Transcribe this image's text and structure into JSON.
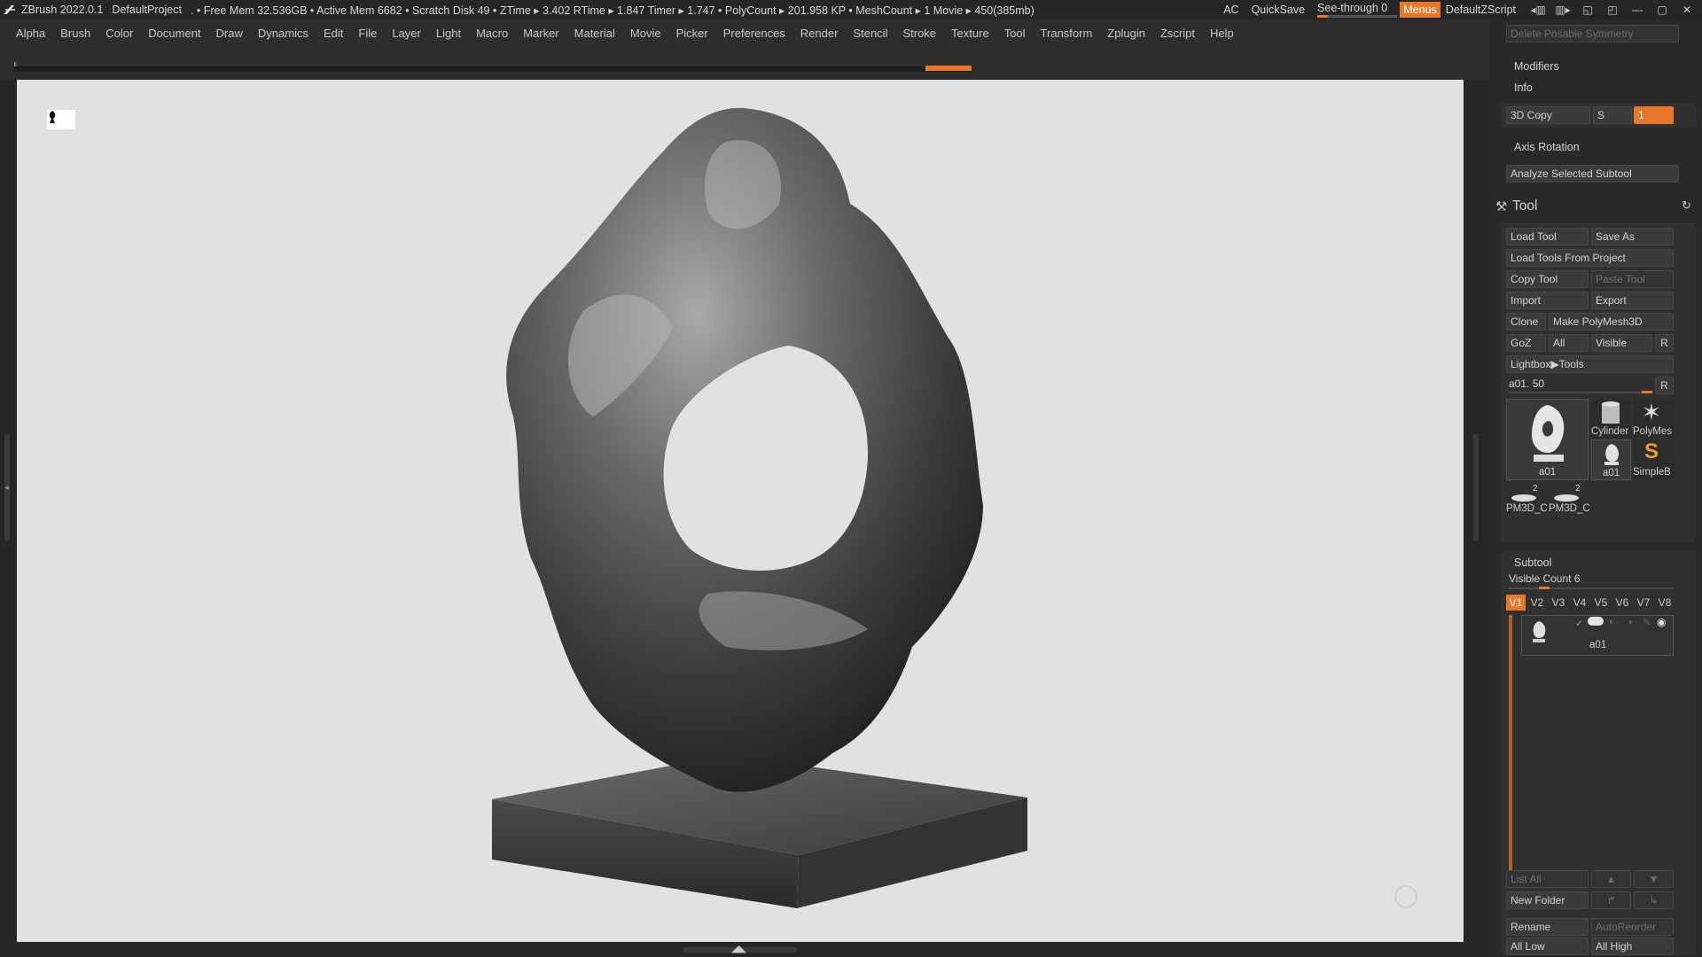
{
  "app": {
    "title": "ZBrush 2022.0.1",
    "project": "DefaultProject",
    "stats": ". • Free Mem 32.536GB • Active Mem 6682 • Scratch Disk 49 • ZTime ▸ 3.402 RTime ▸ 1.847 Timer ▸ 1.747 • PolyCount ▸ 201.958 KP  • MeshCount ▸ 1  Movie ▸ 450(385mb)",
    "ac": "AC",
    "quicksave": "QuickSave",
    "see_through": "See-through  0",
    "menus": "Menus",
    "default_zscript": "DefaultZScript"
  },
  "menu": [
    "Alpha",
    "Brush",
    "Color",
    "Document",
    "Draw",
    "Dynamics",
    "Edit",
    "File",
    "Layer",
    "Light",
    "Macro",
    "Marker",
    "Material",
    "Movie",
    "Picker",
    "Preferences",
    "Render",
    "Stencil",
    "Stroke",
    "Texture",
    "Tool",
    "Transform",
    "Zplugin",
    "Zscript",
    "Help"
  ],
  "panel": {
    "delete_posable_symmetry": "Delete Posable Symmetry",
    "modifiers": "Modifiers",
    "info": "Info",
    "copy3d": "3D Copy",
    "copy3d_s": "S",
    "copy3d_val": "1",
    "axis_rotation": "Axis Rotation",
    "analyze": "Analyze Selected Subtool",
    "tool_title": "Tool",
    "load_tool": "Load Tool",
    "save_as": "Save As",
    "load_from_project": "Load Tools From Project",
    "copy_tool": "Copy Tool",
    "paste_tool": "Paste Tool",
    "import": "Import",
    "export": "Export",
    "clone": "Clone",
    "make_polymesh": "Make PolyMesh3D",
    "goz": "GoZ",
    "all": "All",
    "visible": "Visible",
    "r": "R",
    "lightbox_tools": "Lightbox▶Tools",
    "tool_name": "a01. 50",
    "thumbs": {
      "main": "a01",
      "cylinder": "Cylinder",
      "polymesh": "PolyMes",
      "small_a01": "a01",
      "simpleb": "SimpleB",
      "pm3d_1": "PM3D_C",
      "pm3d_2": "PM3D_C",
      "pm3d_1_badge": "2",
      "pm3d_2_badge": "2"
    },
    "subtool": "Subtool",
    "visible_count": "Visible Count 6",
    "vtabs": [
      "V1",
      "V2",
      "V3",
      "V4",
      "V5",
      "V6",
      "V7",
      "V8"
    ],
    "subtool_item": "a01",
    "list_all": "List All",
    "new_folder": "New Folder",
    "rename": "Rename",
    "auto_reorder": "AutoReorder",
    "all_low": "All Low",
    "all_high": "All High"
  },
  "colors": {
    "accent": "#e8772a",
    "panel_bg": "#292929",
    "canvas_bg": "#e1e1e1"
  },
  "icons": [
    "zbrush-logo-icon",
    "tool-brush-icon",
    "refresh-icon",
    "eye-icon",
    "gyro-icon",
    "arrow-up-icon",
    "arrow-down-icon"
  ]
}
